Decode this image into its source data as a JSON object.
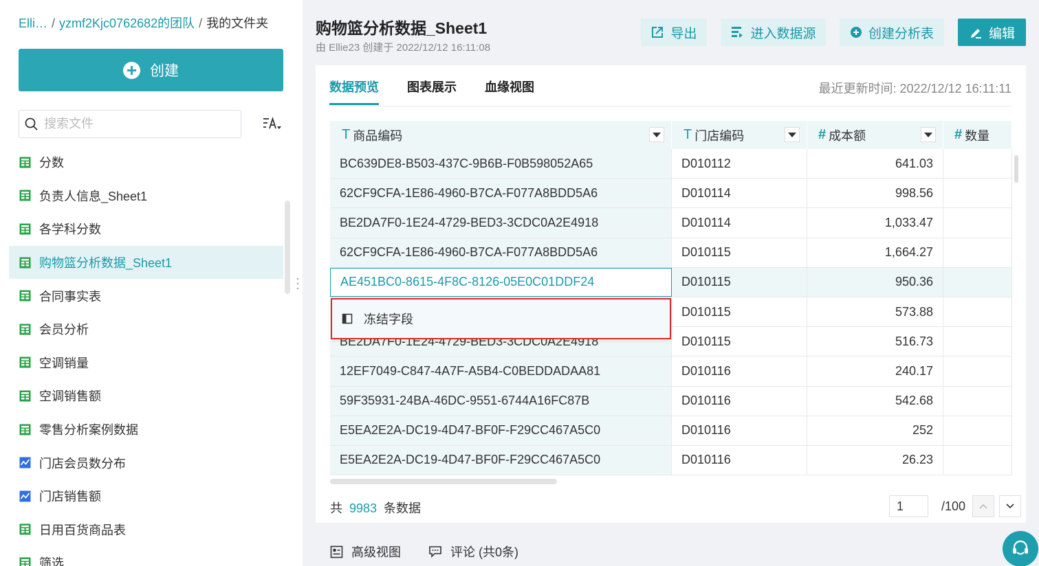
{
  "breadcrumb": {
    "root": "Elli…",
    "team": "yzmf2Kjc0762682的团队",
    "current": "我的文件夹"
  },
  "sidebar": {
    "create_label": "创建",
    "search_placeholder": "搜索文件",
    "items": [
      {
        "label": "分数",
        "icon": "table-icon"
      },
      {
        "label": "负责人信息_Sheet1",
        "icon": "table-icon"
      },
      {
        "label": "各学科分数",
        "icon": "table-icon"
      },
      {
        "label": "购物篮分析数据_Sheet1",
        "icon": "table-icon",
        "active": true
      },
      {
        "label": "合同事实表",
        "icon": "table-icon"
      },
      {
        "label": "会员分析",
        "icon": "table-icon"
      },
      {
        "label": "空调销量",
        "icon": "table-icon"
      },
      {
        "label": "空调销售额",
        "icon": "table-icon"
      },
      {
        "label": "零售分析案例数据",
        "icon": "table-icon"
      },
      {
        "label": "门店会员数分布",
        "icon": "chart-icon"
      },
      {
        "label": "门店销售额",
        "icon": "chart-icon"
      },
      {
        "label": "日用百货商品表",
        "icon": "table-icon"
      },
      {
        "label": "筛选",
        "icon": "table-icon"
      }
    ]
  },
  "header": {
    "title": "购物篮分析数据_Sheet1",
    "meta": "由 Ellie23 创建于 2022/12/12 16:11:08",
    "export_label": "导出",
    "datasource_label": "进入数据源",
    "create_analysis_label": "创建分析表",
    "edit_label": "编辑"
  },
  "tabs": [
    "数据预览",
    "图表展示",
    "血缘视图"
  ],
  "update_time": "最近更新时间: 2022/12/12 16:11:11",
  "table": {
    "columns": [
      {
        "label": "商品编码",
        "type": "T"
      },
      {
        "label": "门店编码",
        "type": "T"
      },
      {
        "label": "成本额",
        "type": "#"
      },
      {
        "label": "数量",
        "type": "#"
      }
    ],
    "rows": [
      [
        "BC639DE8-B503-437C-9B6B-F0B598052A65",
        "D010112",
        "641.03"
      ],
      [
        "62CF9CFA-1E86-4960-B7CA-F077A8BDD5A6",
        "D010114",
        "998.56"
      ],
      [
        "BE2DA7F0-1E24-4729-BED3-3CDC0A2E4918",
        "D010114",
        "1,033.47"
      ],
      [
        "62CF9CFA-1E86-4960-B7CA-F077A8BDD5A6",
        "D010115",
        "1,664.27"
      ],
      [
        "AE451BC0-8615-4F8C-8126-05E0C01DDF24",
        "D010115",
        "950.36"
      ],
      [
        "",
        "D010115",
        "573.88"
      ],
      [
        "BE2DA7F0-1E24-4729-BED3-3CDC0A2E4918",
        "D010115",
        "516.73"
      ],
      [
        "12EF7049-C847-4A7F-A5B4-C0BEDDADAA81",
        "D010116",
        "240.17"
      ],
      [
        "59F35931-24BA-46DC-9551-6744A16FC87B",
        "D010116",
        "542.68"
      ],
      [
        "E5EA2E2A-DC19-4D47-BF0F-F29CC467A5C0",
        "D010116",
        "252"
      ],
      [
        "E5EA2E2A-DC19-4D47-BF0F-F29CC467A5C0",
        "D010116",
        "26.23"
      ]
    ],
    "selected_row": 4
  },
  "context_menu": {
    "label": "冻结字段"
  },
  "footer": {
    "total_prefix": "共",
    "total_count": "9983",
    "total_suffix": "条数据",
    "page_value": "1",
    "page_total": "/100"
  },
  "bottom": {
    "advanced_view": "高级视图",
    "comments": "评论 (共0条)"
  },
  "colors": {
    "accent": "#1d9fad",
    "highlight_border": "#e02828"
  }
}
